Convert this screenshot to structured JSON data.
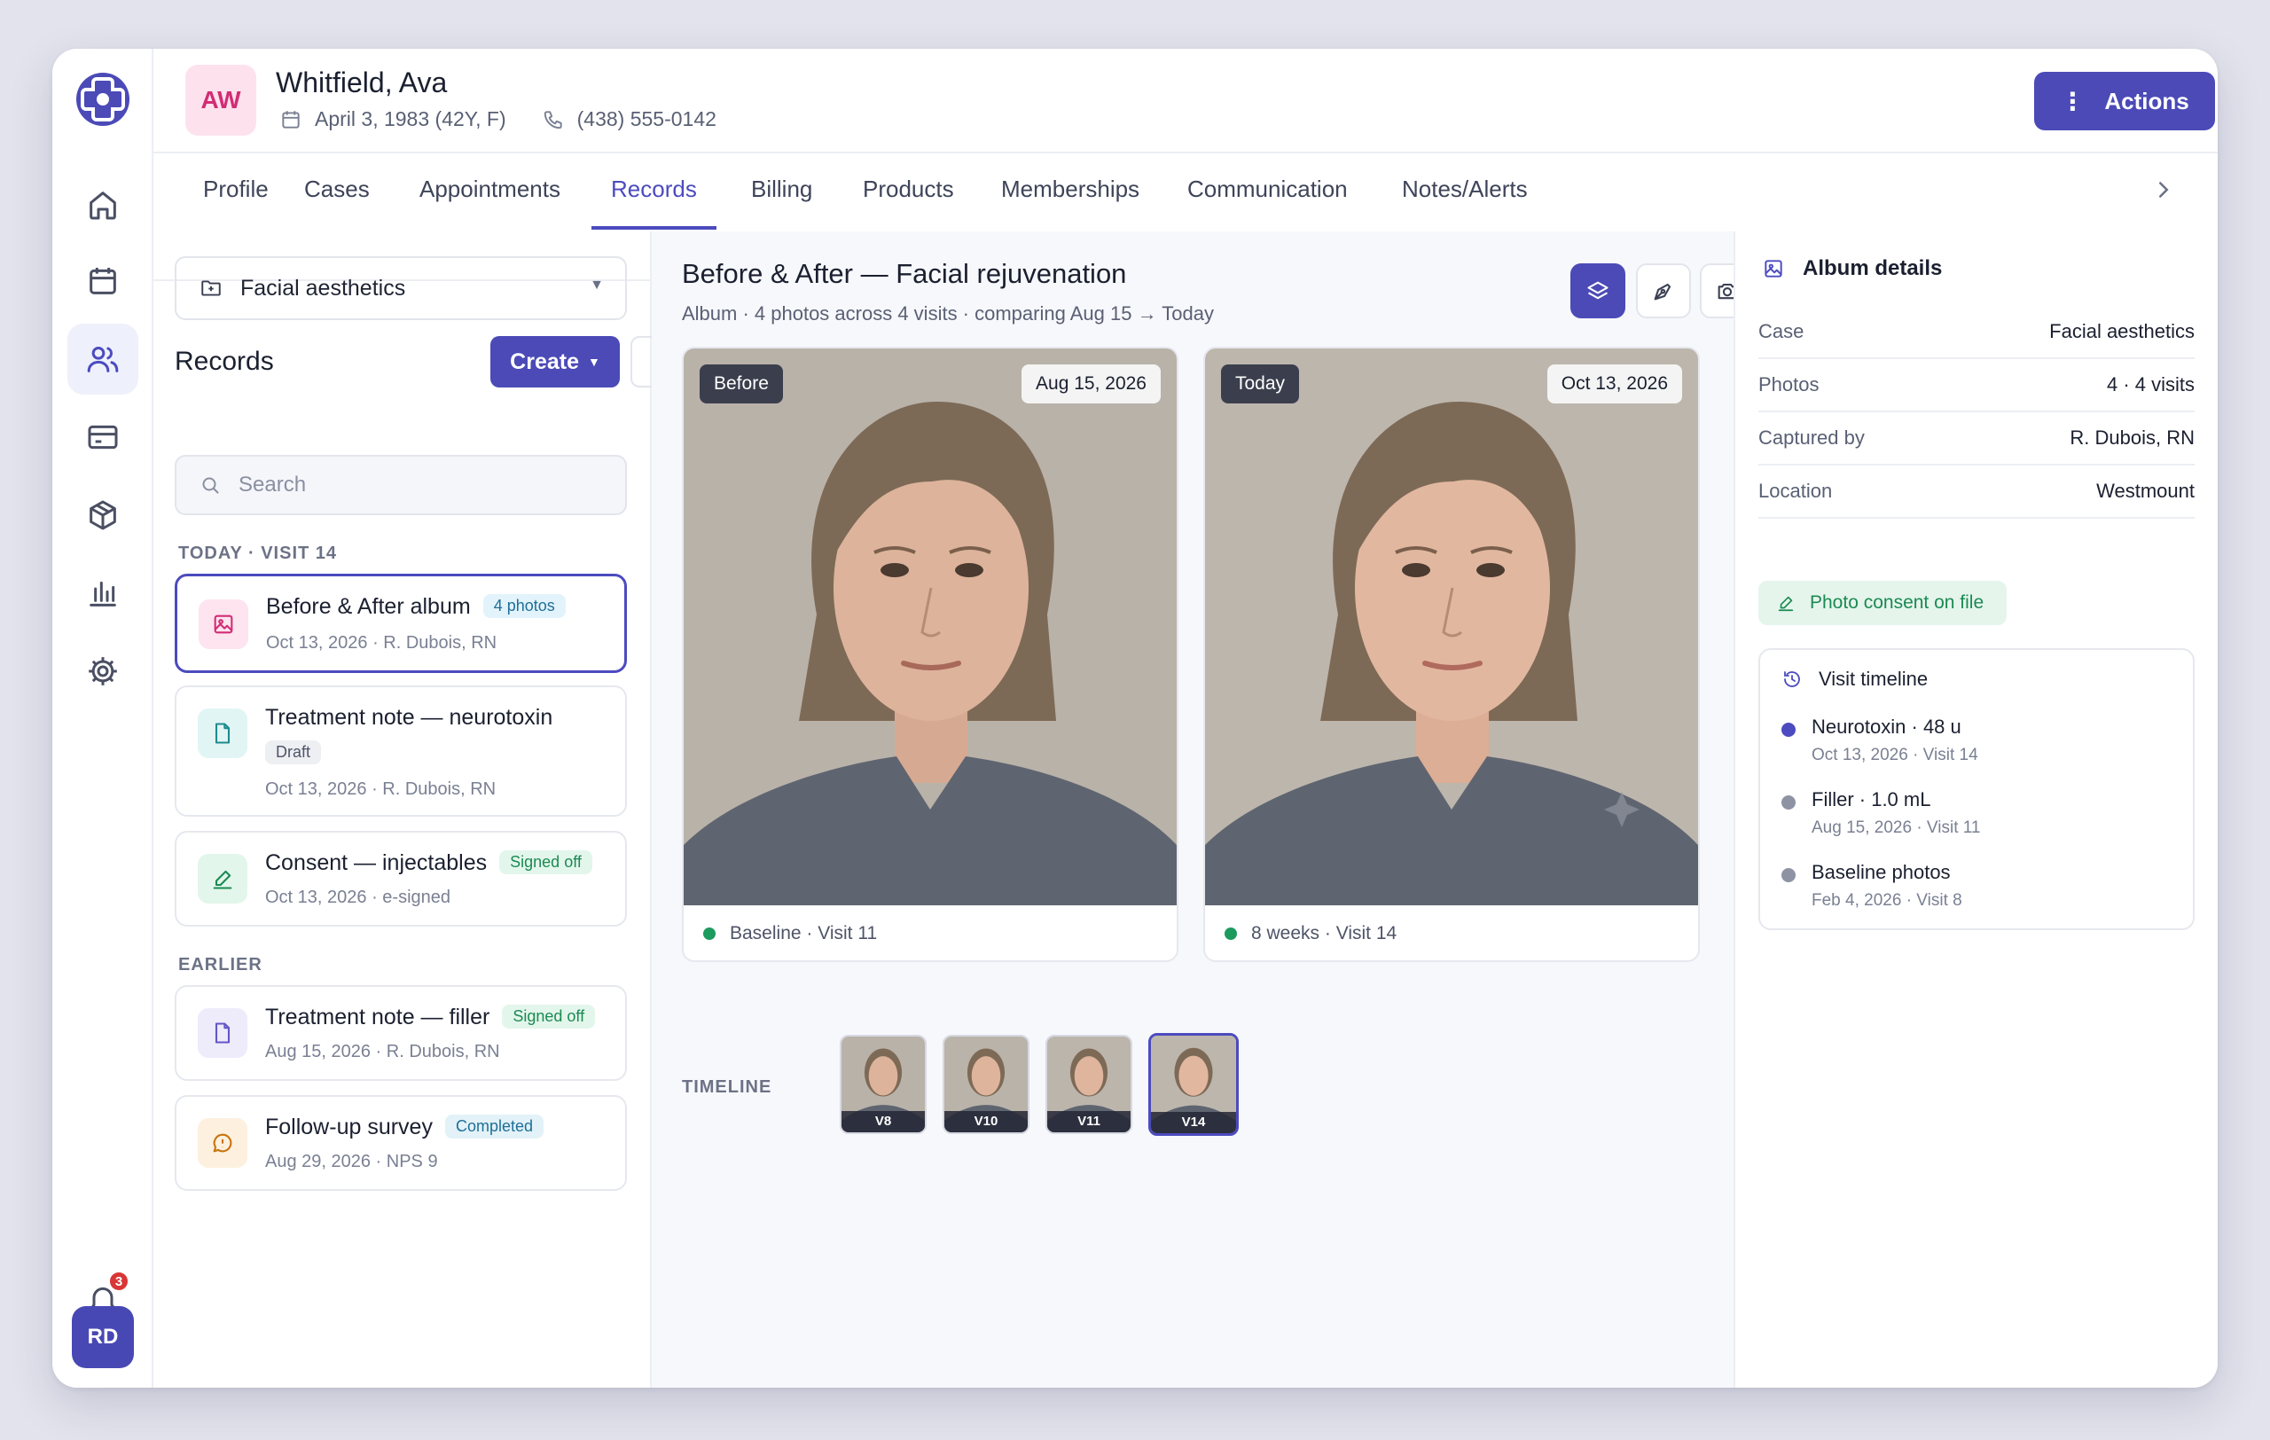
{
  "patient": {
    "initials": "AW",
    "name": "Whitfield, Ava",
    "dob": "April 3, 1983 (42Y, F)",
    "phone": "(438) 555-0142"
  },
  "header": {
    "actions_label": "Actions"
  },
  "tabs": [
    "Profile",
    "Cases",
    "Appointments",
    "Records",
    "Billing",
    "Products",
    "Memberships",
    "Communication",
    "Notes/Alerts"
  ],
  "active_tab": "Records",
  "user": {
    "initials": "RD",
    "notification_count": "3"
  },
  "records_panel": {
    "case_select": "Facial aesthetics",
    "title": "Records",
    "create_label": "Create",
    "search_placeholder": "Search",
    "sections": [
      {
        "label": "TODAY · VISIT 14",
        "items": [
          {
            "name": "Before & After album",
            "badge": "4 photos",
            "meta": "Oct 13, 2026 · R. Dubois, RN",
            "icon": "image-icon"
          },
          {
            "name": "Treatment note — neurotoxin",
            "badge": "Draft",
            "meta": "Oct 13, 2026 · R. Dubois, RN",
            "icon": "document-icon"
          },
          {
            "name": "Consent — injectables",
            "badge": "Signed off",
            "meta": "Oct 13, 2026 · e-signed",
            "icon": "signature-icon"
          }
        ]
      },
      {
        "label": "EARLIER",
        "items": [
          {
            "name": "Treatment note — filler",
            "badge": "Signed off",
            "meta": "Aug 15, 2026 · R. Dubois, RN",
            "icon": "document-icon"
          },
          {
            "name": "Follow-up survey",
            "badge": "Completed",
            "meta": "Aug 29, 2026 · NPS 9",
            "icon": "message-icon"
          }
        ]
      }
    ]
  },
  "album": {
    "title": "Before & After — Facial rejuvenation",
    "subtitle": "Album · 4 photos across 4 visits · comparing Aug 15 → Today",
    "before": {
      "tag": "Before",
      "date": "Aug 15, 2026",
      "caption": "Baseline · Visit 11"
    },
    "after": {
      "tag": "Today",
      "date": "Oct 13, 2026",
      "caption": "8 weeks · Visit 14"
    },
    "timeline_label": "TIMELINE",
    "thumbnails": [
      "V8",
      "V10",
      "V11",
      "V14"
    ]
  },
  "details": {
    "title": "Album details",
    "rows": [
      {
        "key": "Case",
        "value": "Facial aesthetics"
      },
      {
        "key": "Photos",
        "value": "4 · 4 visits"
      },
      {
        "key": "Captured by",
        "value": "R. Dubois, RN"
      },
      {
        "key": "Location",
        "value": "Westmount"
      }
    ],
    "consent": "Photo consent on file",
    "visit_timeline": {
      "title": "Visit timeline",
      "items": [
        {
          "name": "Neurotoxin · 48 u",
          "meta": "Oct 13, 2026 · Visit 14",
          "color": "#4c4bbf"
        },
        {
          "name": "Filler · 1.0 mL",
          "meta": "Aug 15, 2026 · Visit 11",
          "color": "#8e93a4"
        },
        {
          "name": "Baseline photos",
          "meta": "Feb 4, 2026 · Visit 8",
          "color": "#8e93a4"
        }
      ]
    }
  },
  "colors": {
    "accent": "#4b4ab7",
    "success": "#1d9a5e",
    "brand_pink": "#d12d74"
  }
}
